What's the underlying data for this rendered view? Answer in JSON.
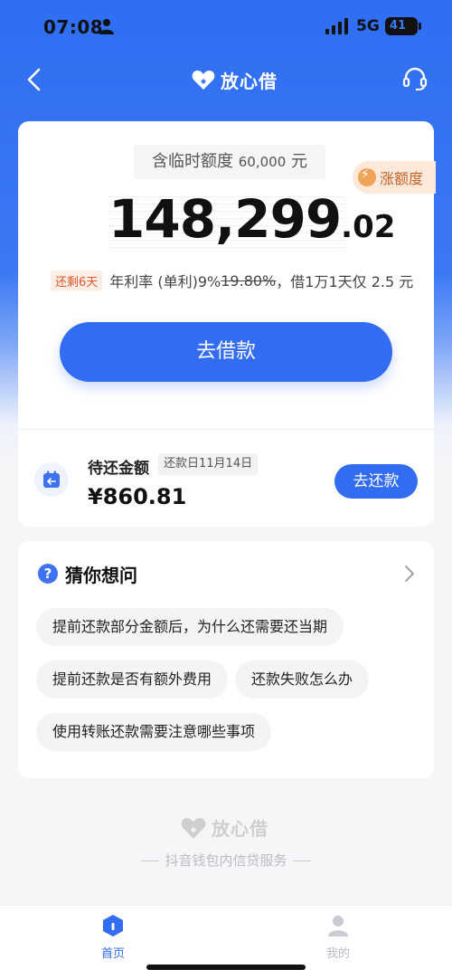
{
  "status_bar": {
    "time": "07:08",
    "network": "5G",
    "battery": "41"
  },
  "nav": {
    "brand": "放心借"
  },
  "quota": {
    "temp_label": "含临时额度",
    "temp_amount": "60,000",
    "temp_unit": "元",
    "boost_label": "涨额度",
    "amount_int": "148,299",
    "amount_dec": ".02",
    "days_badge": "还剩6天",
    "rate_prefix": "年利率 (单利)9%",
    "rate_old": "19.80%",
    "rate_suffix": "，借1万1天仅 2.5 元",
    "borrow_button": "去借款"
  },
  "repay": {
    "title": "待还金额",
    "date": "还款日11月14日",
    "amount": "¥860.81",
    "button": "去还款"
  },
  "faq": {
    "title": "猜你想问",
    "questions": [
      "提前还款部分金额后，为什么还需要还当期",
      "提前还款是否有额外费用",
      "还款失败怎么办",
      "使用转账还款需要注意哪些事项"
    ]
  },
  "footer": {
    "brand": "放心借",
    "subtitle": "抖音钱包内信贷服务"
  },
  "tabbar": {
    "home": "首页",
    "me": "我的"
  },
  "colors": {
    "primary": "#326cf0",
    "accent_orange": "#c2642a",
    "badge_red": "#e2552c"
  }
}
